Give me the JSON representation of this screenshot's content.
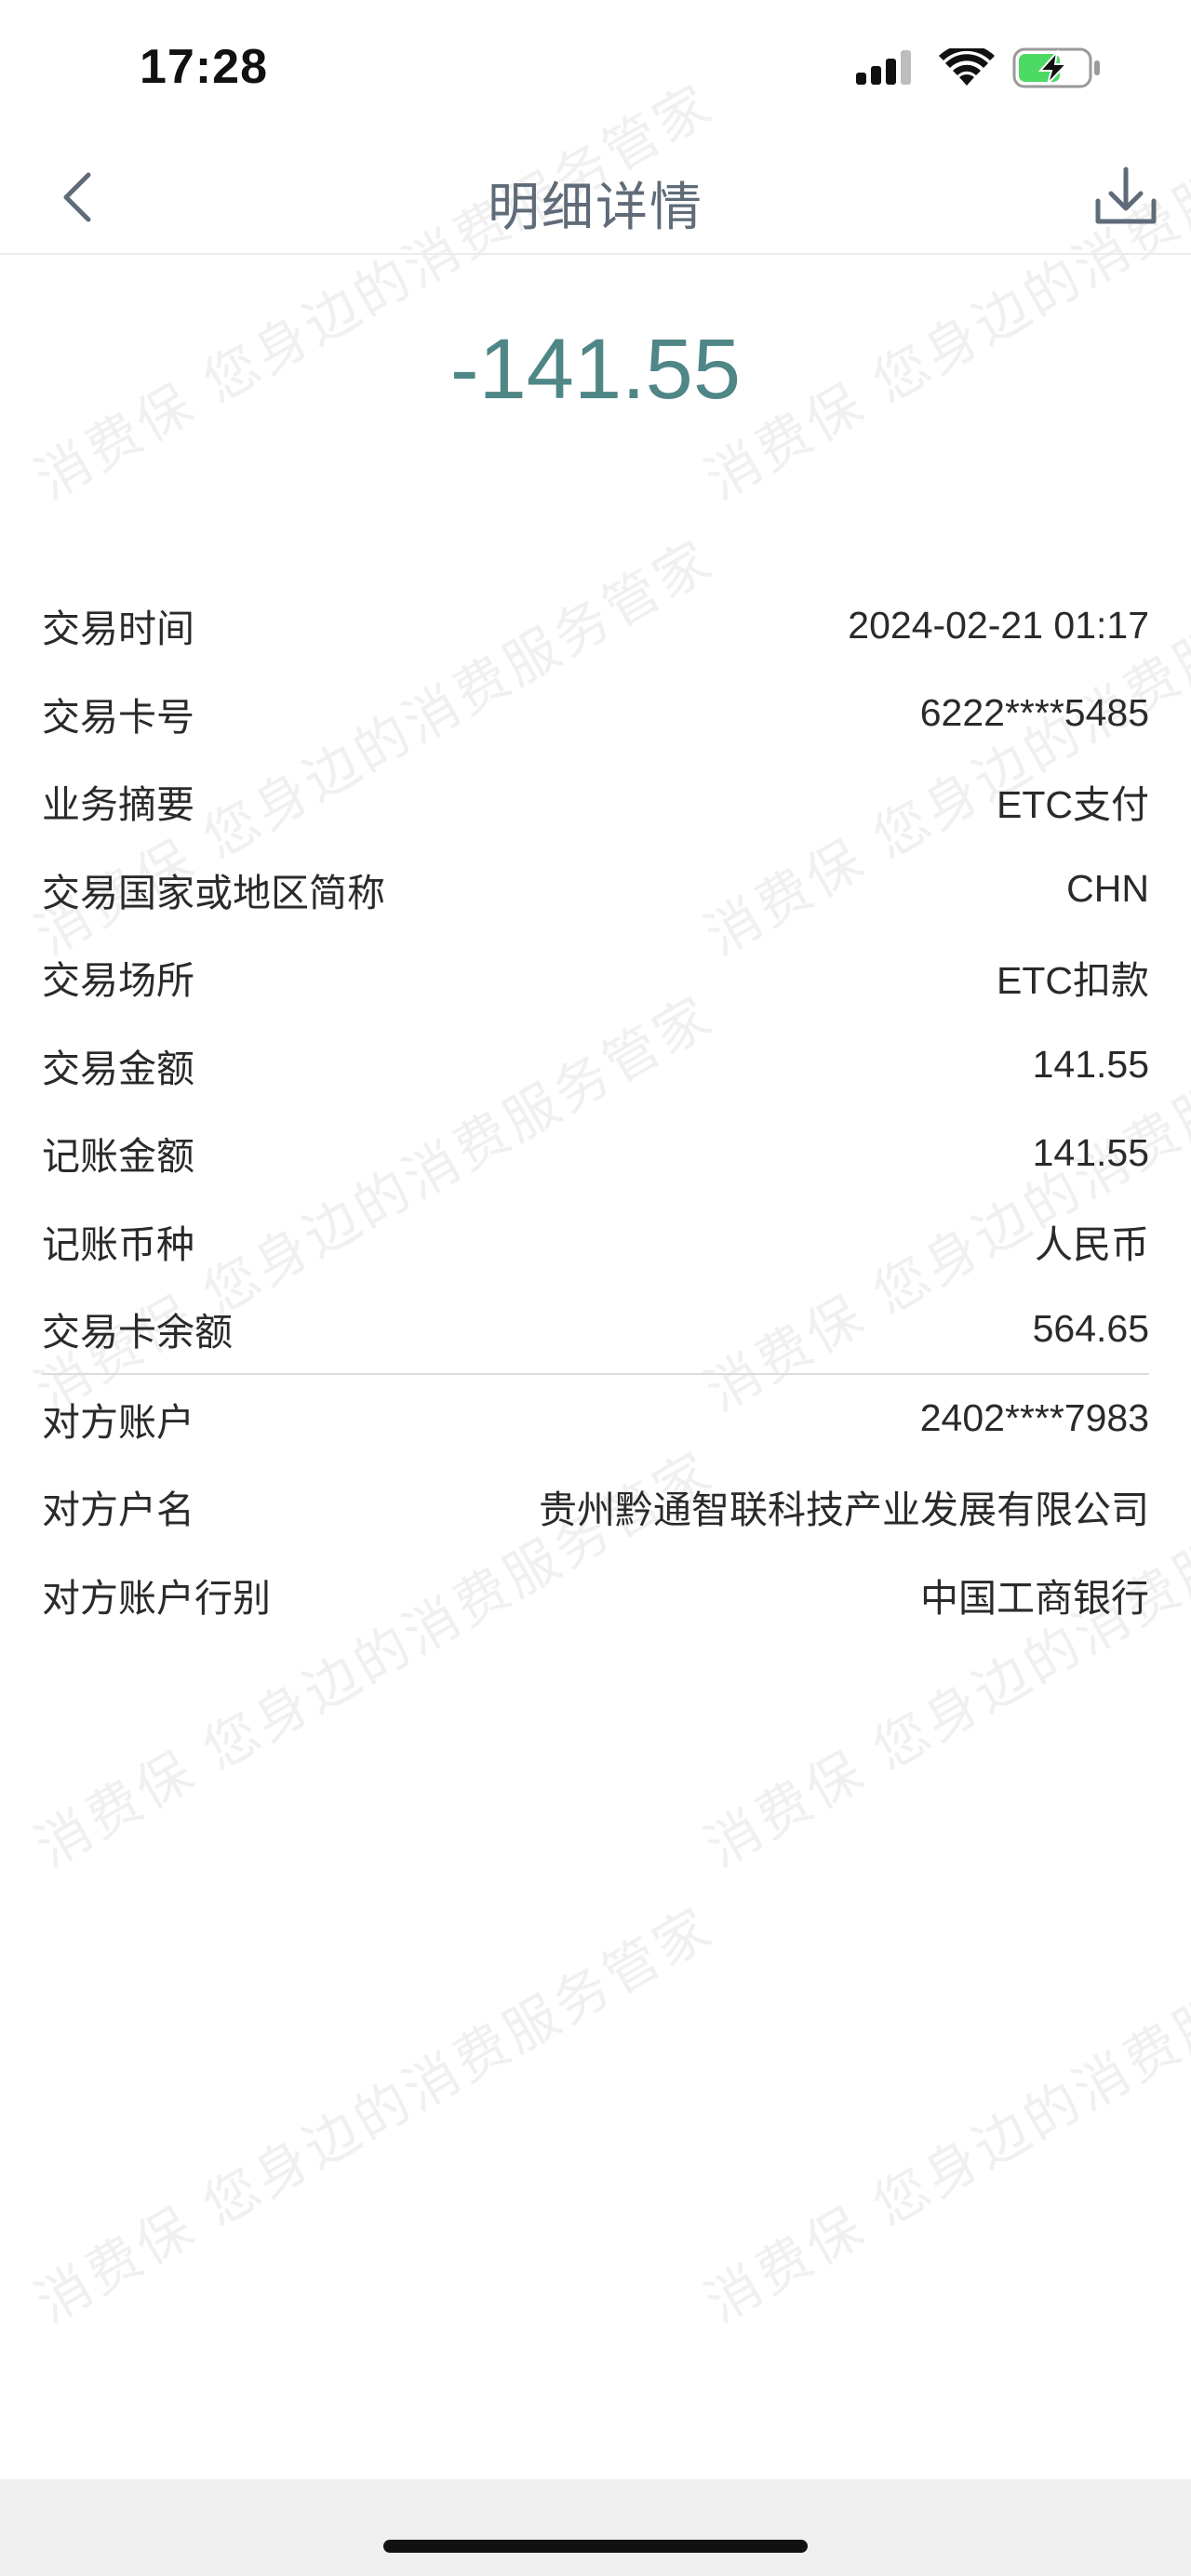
{
  "status_bar": {
    "time": "17:28"
  },
  "nav": {
    "title": "明细详情",
    "back_icon": "chevron-left-icon",
    "download_icon": "download-icon"
  },
  "amount": "-141.55",
  "details": [
    {
      "label": "交易时间",
      "value": "2024-02-21 01:17"
    },
    {
      "label": "交易卡号",
      "value": "6222****5485"
    },
    {
      "label": "业务摘要",
      "value": "ETC支付"
    },
    {
      "label": "交易国家或地区简称",
      "value": "CHN"
    },
    {
      "label": "交易场所",
      "value": "ETC扣款"
    },
    {
      "label": "交易金额",
      "value": "141.55"
    },
    {
      "label": "记账金额",
      "value": "141.55"
    },
    {
      "label": "记账币种",
      "value": "人民币"
    },
    {
      "label": "交易卡余额",
      "value": "564.65"
    }
  ],
  "counterparty": [
    {
      "label": "对方账户",
      "value": "2402****7983"
    },
    {
      "label": "对方户名",
      "value": "贵州黔通智联科技产业发展有限公司"
    },
    {
      "label": "对方账户行别",
      "value": "中国工商银行"
    }
  ],
  "watermark_text": "消费保 您身边的消费服务管家",
  "colors": {
    "amount": "#4f8686",
    "title": "#5f6b78",
    "icon": "#5f6b78",
    "battery_fill": "#4cd964"
  }
}
